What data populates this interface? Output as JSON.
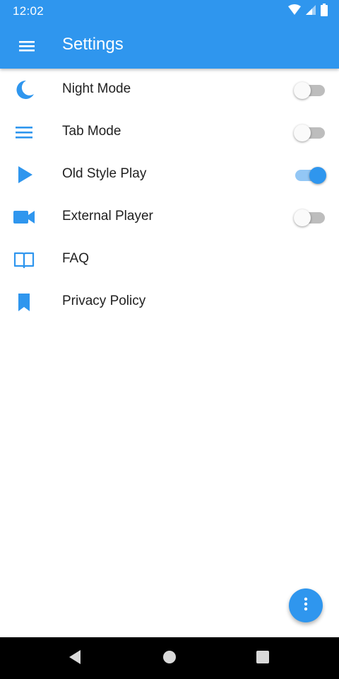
{
  "status": {
    "time": "12:02",
    "icons": [
      "wifi-icon",
      "signal-icon",
      "battery-icon"
    ]
  },
  "toolbar": {
    "title": "Settings",
    "menu_icon": "menu-icon"
  },
  "colors": {
    "primary": "#2f96ee",
    "text": "#212121",
    "switch_off_track": "#bdbdbd",
    "switch_on_track": "#93c7f5"
  },
  "settings": {
    "items": [
      {
        "label": "Night Mode",
        "icon": "moon-icon",
        "has_switch": true,
        "on": false
      },
      {
        "label": "Tab Mode",
        "icon": "list-icon",
        "has_switch": true,
        "on": false
      },
      {
        "label": "Old Style Play",
        "icon": "play-icon",
        "has_switch": true,
        "on": true
      },
      {
        "label": "External Player",
        "icon": "videocam-icon",
        "has_switch": true,
        "on": false
      },
      {
        "label": "FAQ",
        "icon": "book-icon",
        "has_switch": false
      },
      {
        "label": "Privacy Policy",
        "icon": "bookmark-icon",
        "has_switch": false
      }
    ]
  },
  "fab": {
    "icon": "more-vertical-icon"
  },
  "navbar": {
    "icons": [
      "back-icon",
      "home-icon",
      "recents-icon"
    ]
  }
}
